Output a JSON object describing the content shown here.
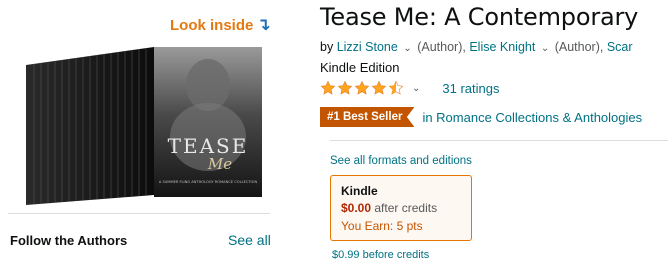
{
  "look_inside": {
    "label": "Look inside",
    "arrow": "↴"
  },
  "book": {
    "cover_title": "TEASE",
    "cover_script": "Me",
    "cover_subtitle": "A SUMMER FLING ANTHOLOGY ROMANCE COLLECTION"
  },
  "authors_section": {
    "heading": "Follow the Authors",
    "see_all": "See all"
  },
  "product": {
    "title": "Tease Me: A Contemporary",
    "by": "by",
    "authors": [
      {
        "name": "Lizzi Stone",
        "role": "(Author),"
      },
      {
        "name": "Elise Knight",
        "role": "(Author),"
      },
      {
        "name": "Scar",
        "role": ""
      }
    ],
    "edition": "Kindle Edition",
    "rating": 4.5,
    "ratings_count": "31 ratings",
    "badge": "#1 Best Seller",
    "badge_category": "in Romance Collections & Anthologies"
  },
  "formats": {
    "see_all_link": "See all formats and editions",
    "kindle": {
      "label": "Kindle",
      "price": "$0.00",
      "price_note": "after credits",
      "earn": "You Earn: 5 pts"
    },
    "before_credits": "$0.99 before credits"
  },
  "colors": {
    "accent_orange": "#e47911",
    "link": "#007185",
    "badge": "#c45500",
    "price": "#b12704",
    "star": "#ffa41c"
  }
}
